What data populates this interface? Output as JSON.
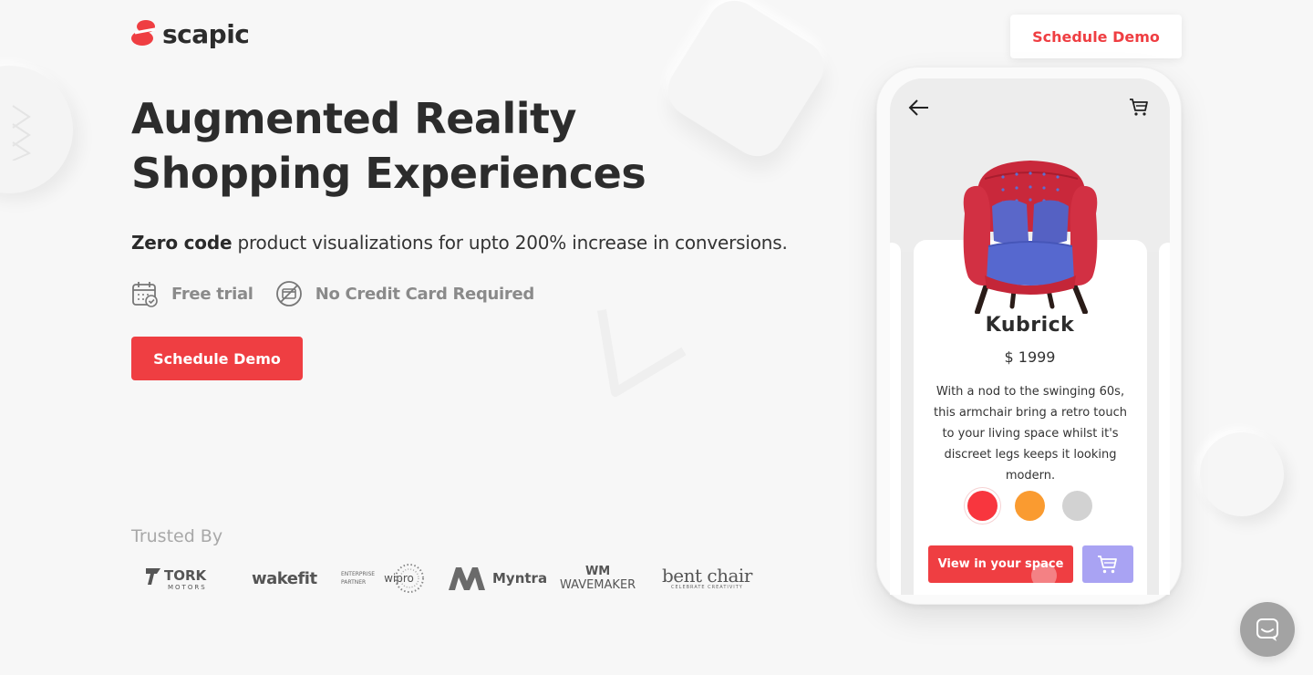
{
  "brand": {
    "name": "scapic",
    "accent": "#ef3e42"
  },
  "header": {
    "cta_label": "Schedule Demo"
  },
  "hero": {
    "title_line1": "Augmented Reality",
    "title_line2": "Shopping Experiences",
    "subtitle_bold": "Zero code",
    "subtitle_rest": " product visualizations for upto 200% increase in conversions.",
    "features": [
      {
        "icon": "calendar-icon",
        "label": "Free trial"
      },
      {
        "icon": "no-credit-card-icon",
        "label": "No Credit Card Required"
      }
    ],
    "cta_label": "Schedule Demo"
  },
  "trusted": {
    "label": "Trusted By",
    "brands": [
      {
        "name": "TORK",
        "sub": "MOTORS"
      },
      {
        "name": "wakefit"
      },
      {
        "name": "wipro",
        "sub1": "ENTERPRISE",
        "sub2": "PARTNER"
      },
      {
        "name": "Myntra"
      },
      {
        "name": "WAVEMAKER",
        "mark": "WM"
      },
      {
        "name": "bent chair",
        "sub": "CELEBRATE CREATIVITY"
      }
    ]
  },
  "phone": {
    "product": {
      "name": "Kubrick",
      "price": "$ 1999",
      "description": "With a nod to the swinging 60s, this armchair bring a retro touch to your living space whilst it's discreet legs keeps it looking modern."
    },
    "swatches": [
      "#f8363e",
      "#fa9b30",
      "#d2d2d2"
    ],
    "view_button_label": "View in your space",
    "cart_button_color": "#a9a3f3"
  }
}
